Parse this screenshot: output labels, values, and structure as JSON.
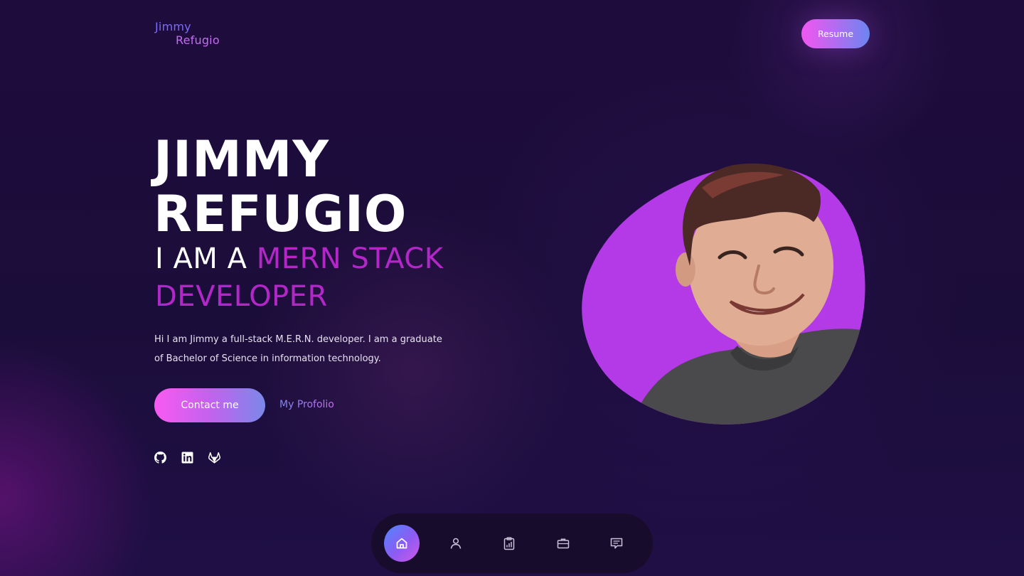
{
  "header": {
    "logo_first": "Jimmy",
    "logo_last": "Refugio",
    "resume_label": "Resume"
  },
  "hero": {
    "name_line1": "JIMMY",
    "name_line2": "REFUGIO",
    "role_prefix": "I AM A",
    "role_highlight_line1": "MERN STACK",
    "role_highlight_line2": "DEVELOPER",
    "intro": "Hi I am Jimmy a full-stack M.E.R.N. developer. I am a graduate of Bachelor of Science in information technology.",
    "contact_label": "Contact me",
    "portfolio_label": "My Profolio"
  },
  "socials": [
    {
      "icon": "github-icon"
    },
    {
      "icon": "linkedin-icon"
    },
    {
      "icon": "gitlab-icon"
    }
  ],
  "bottom_nav": [
    {
      "icon": "home-icon",
      "active": true
    },
    {
      "icon": "user-icon",
      "active": false
    },
    {
      "icon": "clipboard-chart-icon",
      "active": false
    },
    {
      "icon": "briefcase-icon",
      "active": false
    },
    {
      "icon": "message-icon",
      "active": false
    }
  ],
  "colors": {
    "background": "#1c0d3b",
    "accent_purple": "#b327c8",
    "gradient_pink": "#f85af0",
    "gradient_blue": "#6a86f0",
    "avatar_blob": "#b43ae8"
  }
}
